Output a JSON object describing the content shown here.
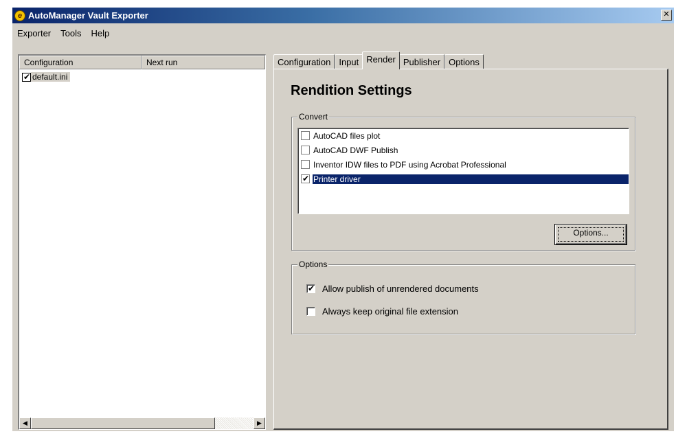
{
  "window": {
    "title": "AutoManager Vault Exporter",
    "app_icon_glyph": "e",
    "close_glyph": "✕"
  },
  "menu": {
    "items": [
      "Exporter",
      "Tools",
      "Help"
    ]
  },
  "config_list": {
    "columns": [
      "Configuration",
      "Next run"
    ],
    "rows": [
      {
        "label": "default.ini",
        "checked": true
      }
    ],
    "scroll_left_glyph": "◀",
    "scroll_right_glyph": "▶"
  },
  "tabs": [
    {
      "label": "Configuration",
      "active": false
    },
    {
      "label": "Input",
      "active": false
    },
    {
      "label": "Render",
      "active": true
    },
    {
      "label": "Publisher",
      "active": false
    },
    {
      "label": "Options",
      "active": false
    }
  ],
  "render_page": {
    "title": "Rendition Settings",
    "convert_group": {
      "caption": "Convert",
      "items": [
        {
          "label": "AutoCAD files plot",
          "checked": false,
          "selected": false
        },
        {
          "label": "AutoCAD DWF Publish",
          "checked": false,
          "selected": false
        },
        {
          "label": "Inventor IDW files to PDF using Acrobat Professional",
          "checked": false,
          "selected": false
        },
        {
          "label": "Printer driver",
          "checked": true,
          "selected": true
        }
      ],
      "options_button": "Options..."
    },
    "options_group": {
      "caption": "Options",
      "items": [
        {
          "label": "Allow publish of unrendered documents",
          "checked": true
        },
        {
          "label": "Always keep original file extension",
          "checked": false
        }
      ]
    }
  },
  "colors": {
    "titlebar_start": "#0a246a",
    "titlebar_end": "#a6caf0",
    "selection": "#0a246a",
    "face": "#d4d0c8"
  }
}
